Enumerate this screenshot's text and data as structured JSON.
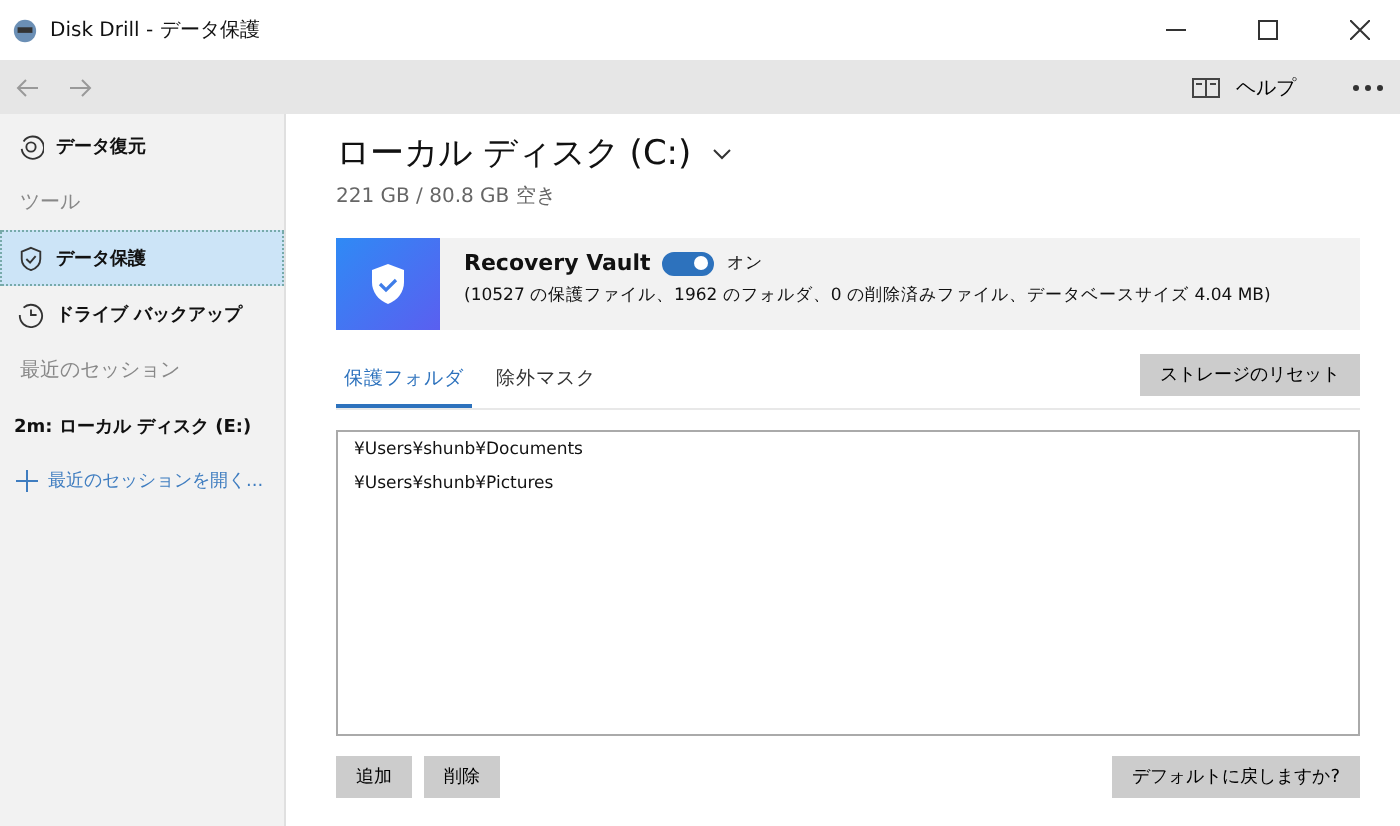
{
  "window": {
    "title": "Disk Drill - データ保護"
  },
  "toolbar": {
    "help": "ヘルプ"
  },
  "sidebar": {
    "items": [
      {
        "kind": "item",
        "label": "データ復元",
        "selected": false
      },
      {
        "kind": "header",
        "label": "ツール"
      },
      {
        "kind": "item",
        "label": "データ保護",
        "selected": true
      },
      {
        "kind": "item",
        "label": "ドライブ バックアップ",
        "selected": false
      },
      {
        "kind": "header",
        "label": "最近のセッション"
      },
      {
        "kind": "session",
        "label": "2m: ローカル ディスク (E:)",
        "selected": false
      },
      {
        "kind": "link",
        "label": "最近のセッションを開く..."
      }
    ]
  },
  "disk": {
    "title": "ローカル ディスク (C:)",
    "subtitle": "221 GB / 80.8 GB 空き"
  },
  "vault": {
    "name": "Recovery Vault",
    "on": true,
    "state_label": "オン",
    "details": "(10527 の保護ファイル、1962 のフォルダ、0 の削除済みファイル、データベースサイズ 4.04 MB)"
  },
  "tabs": [
    {
      "label": "保護フォルダ",
      "selected": true
    },
    {
      "label": "除外マスク",
      "selected": false
    }
  ],
  "reset_button": "ストレージのリセット",
  "folders": [
    "¥Users¥shunb¥Documents",
    "¥Users¥shunb¥Pictures"
  ],
  "buttons": {
    "add": "追加",
    "remove": "削除",
    "defaults": "デフォルトに戻しますか?"
  }
}
